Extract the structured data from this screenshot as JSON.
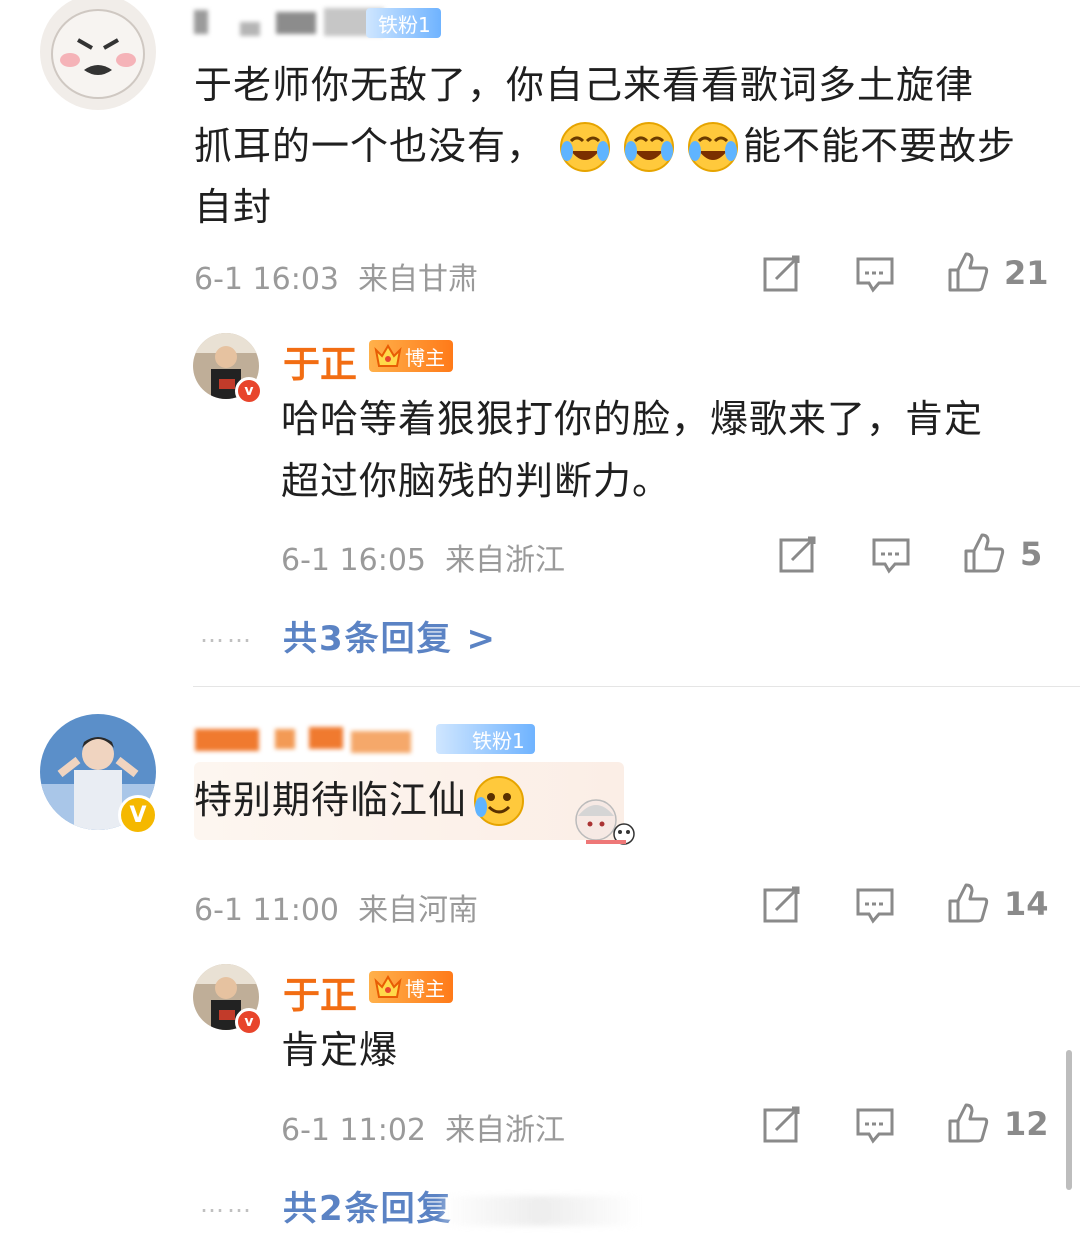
{
  "comments": [
    {
      "badge": "铁粉1",
      "text_line1": "于老师你无敌了，你自己来看看歌词多土旋律",
      "text_line2": "抓耳的一个也没有，",
      "text_line2_after": "能不能不要故步",
      "text_line3": "自封",
      "emoji": "cry-laugh-emoji",
      "meta": "6-1 16:03  来自甘肃",
      "likes": "21",
      "reply": {
        "name": "于正",
        "badge": "博主",
        "text_line1": "哈哈等着狠狠打你的脸，爆歌来了，肯定",
        "text_line2": "超过你脑残的判断力。",
        "meta": "6-1 16:05  来自浙江",
        "likes": "5"
      },
      "more_replies": "共3条回复 >",
      "dots": "……"
    },
    {
      "badge": "铁粉1",
      "text": "特别期待临江仙",
      "meta": "6-1 11:00  来自河南",
      "likes": "14",
      "reply": {
        "name": "于正",
        "badge": "博主",
        "text": "肯定爆",
        "meta": "6-1 11:02  来自浙江",
        "likes": "12"
      },
      "more_replies": "共2条回复",
      "dots": "……"
    }
  ],
  "colors": {
    "name_orange": "#f26d13",
    "link_blue": "#5b83c4",
    "meta_gray": "#9a9a9a",
    "verify_red": "#e8452c",
    "verify_yellow": "#f5b800"
  }
}
